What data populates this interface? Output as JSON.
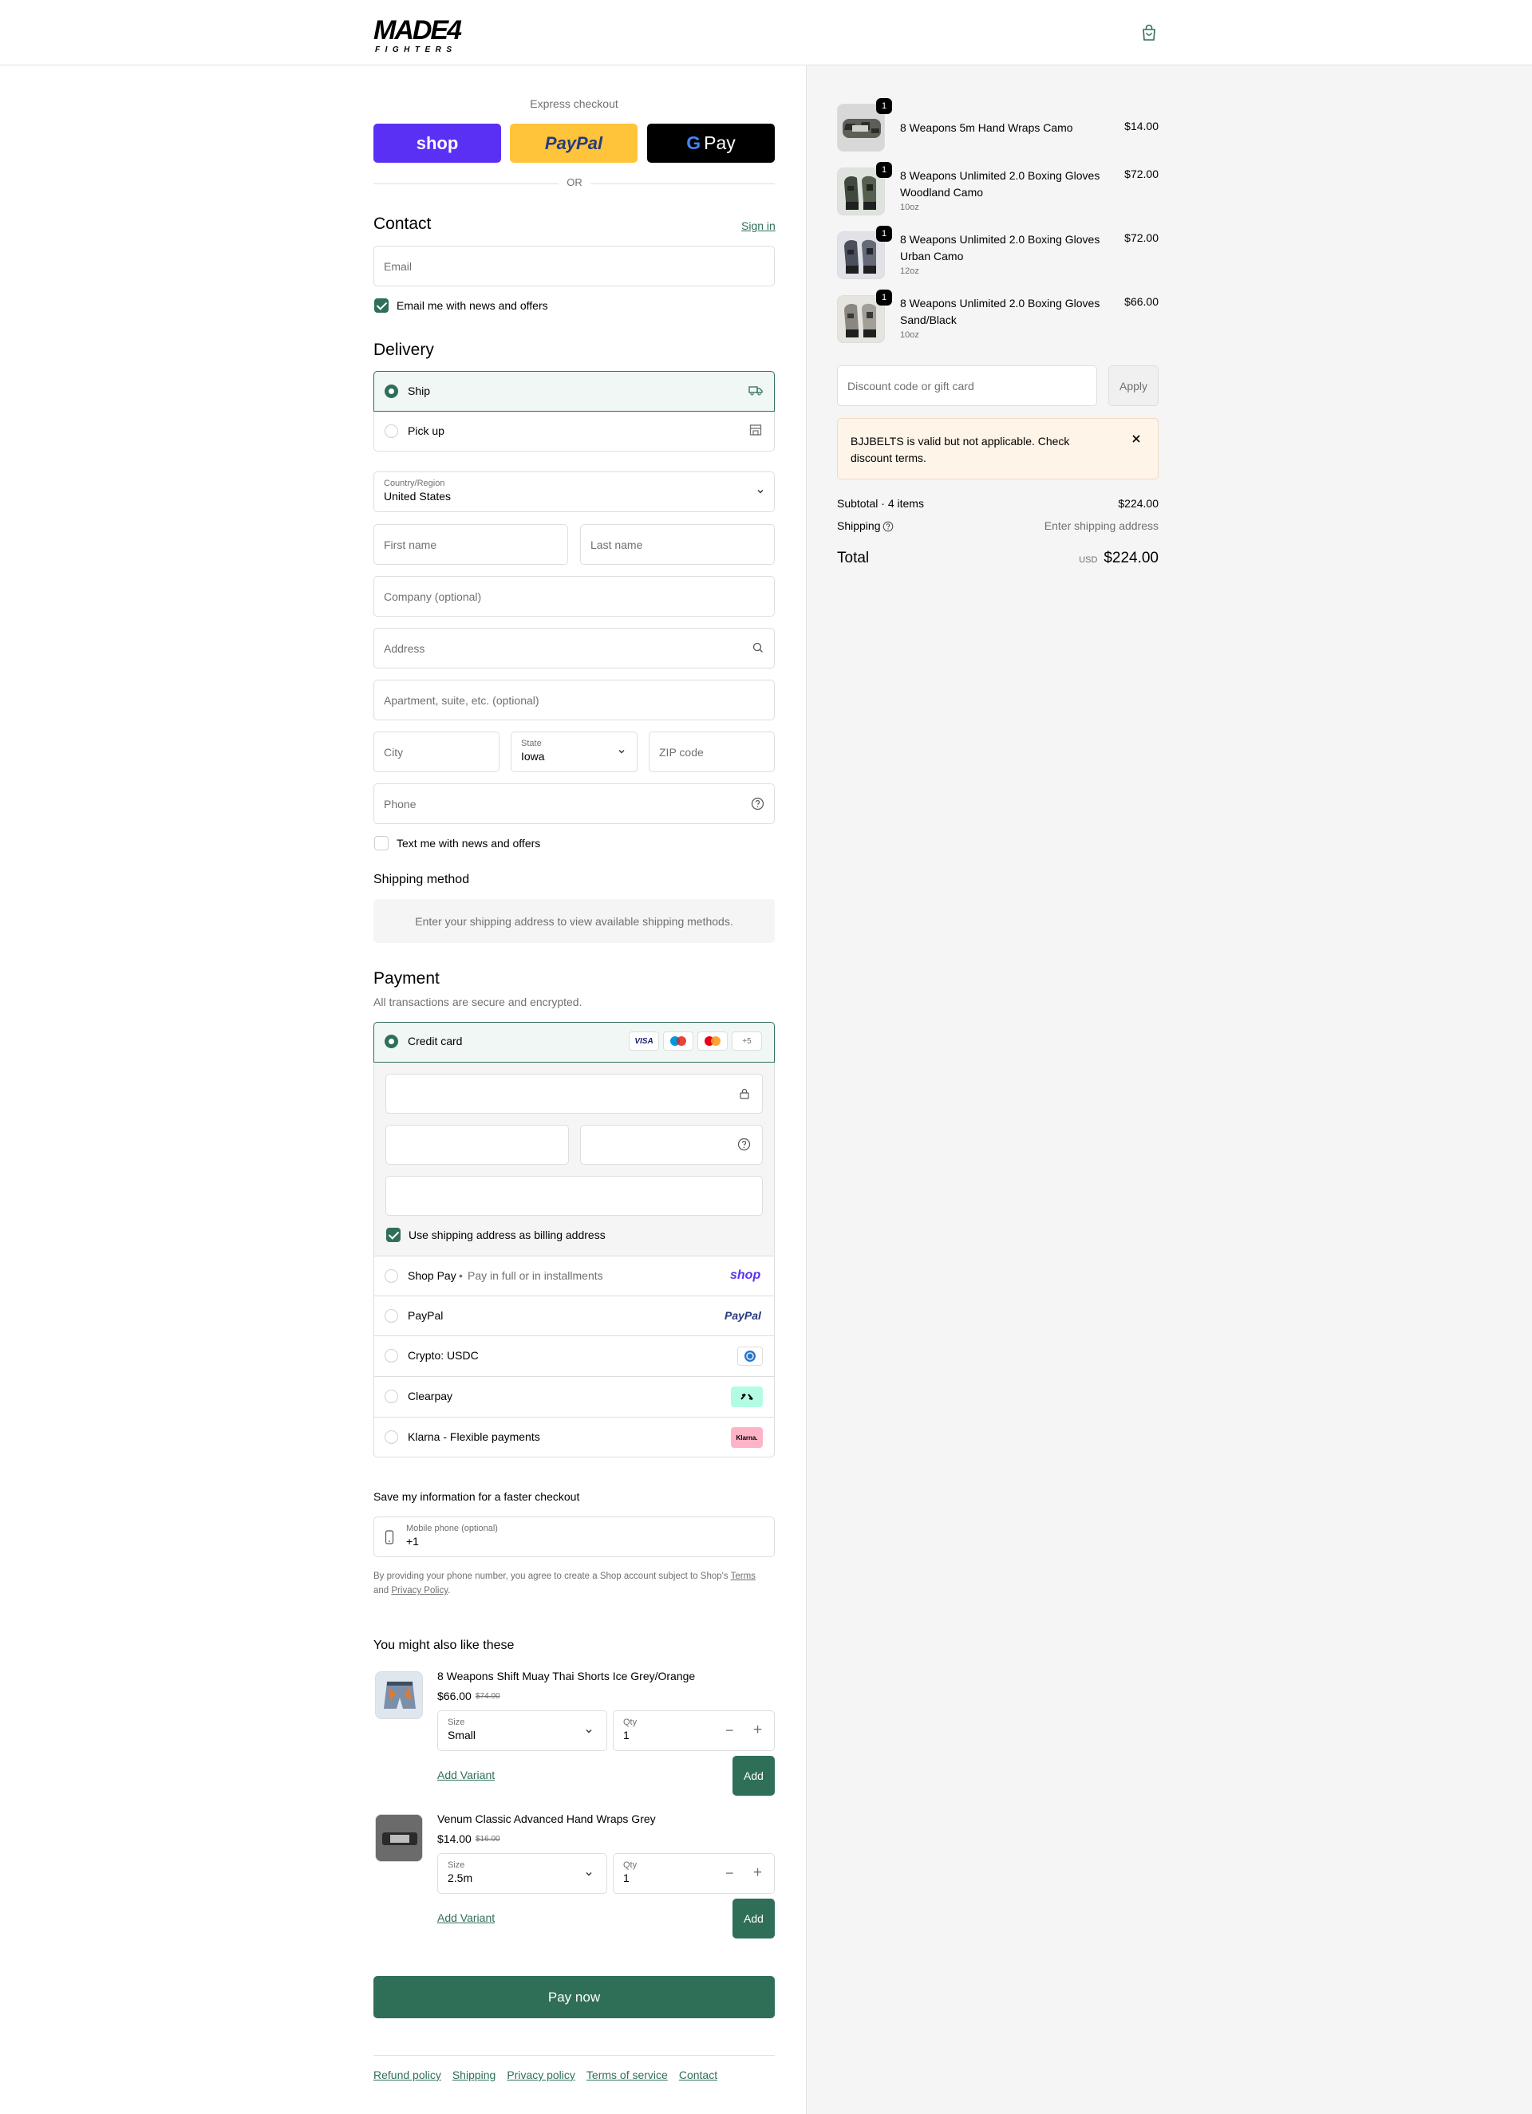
{
  "header": {
    "logo_text": "MADE4",
    "logo_sub": "FIGHTERS",
    "cart_icon": "shopping-bag-icon"
  },
  "express": {
    "title": "Express checkout",
    "shop_label": "shop",
    "paypal_label": "PayPal",
    "gpay_label": "Pay",
    "or": "OR"
  },
  "contact": {
    "title": "Contact",
    "sign_in": "Sign in",
    "email_placeholder": "Email",
    "news_label": "Email me with news and offers"
  },
  "delivery": {
    "title": "Delivery",
    "ship": "Ship",
    "pickup": "Pick up",
    "country_label": "Country/Region",
    "country_value": "United States",
    "first_name": "First name",
    "last_name": "Last name",
    "company": "Company (optional)",
    "address": "Address",
    "apartment": "Apartment, suite, etc. (optional)",
    "city": "City",
    "state_label": "State",
    "state_value": "Iowa",
    "zip": "ZIP code",
    "phone": "Phone",
    "text_label": "Text me with news and offers"
  },
  "shipping_method": {
    "title": "Shipping method",
    "note": "Enter your shipping address to view available shipping methods."
  },
  "payment": {
    "title": "Payment",
    "subtitle": "All transactions are secure and encrypted.",
    "credit_card": "Credit card",
    "card_visa": "VISA",
    "card_more": "+5",
    "billing_label": "Use shipping address as billing address",
    "shop_pay": "Shop Pay",
    "shop_pay_note": "Pay in full or in installments",
    "shop_pay_logo": "shop",
    "paypal": "PayPal",
    "paypal_logo": "PayPal",
    "crypto": "Crypto: USDC",
    "clearpay": "Clearpay",
    "klarna": "Klarna - Flexible payments",
    "klarna_logo": "Klarna."
  },
  "save_info": {
    "title": "Save my information for a faster checkout",
    "phone_label": "Mobile phone (optional)",
    "phone_value": "+1",
    "legal_1": "By providing your phone number, you agree to create a Shop account subject to Shop's",
    "terms": "Terms",
    "and": "and",
    "privacy": "Privacy Policy",
    "period": "."
  },
  "upsell": {
    "title": "You might also like these",
    "items": [
      {
        "name": "8 Weapons Shift Muay Thai Shorts Ice Grey/Orange",
        "price": "$66.00",
        "compare": "$74.00",
        "size_label": "Size",
        "size_value": "Small",
        "qty_label": "Qty",
        "qty_value": "1",
        "add_variant": "Add Variant",
        "add": "Add"
      },
      {
        "name": "Venum Classic Advanced Hand Wraps Grey",
        "price": "$14.00",
        "compare": "$16.00",
        "size_label": "Size",
        "size_value": "2.5m",
        "qty_label": "Qty",
        "qty_value": "1",
        "add_variant": "Add Variant",
        "add": "Add"
      }
    ]
  },
  "pay_now": "Pay now",
  "footer": {
    "links": [
      "Refund policy",
      "Shipping",
      "Privacy policy",
      "Terms of service",
      "Contact"
    ]
  },
  "summary": {
    "items": [
      {
        "qty": "1",
        "name": "8 Weapons 5m Hand Wraps Camo",
        "variant": "",
        "price": "$14.00"
      },
      {
        "qty": "1",
        "name": "8 Weapons Unlimited 2.0 Boxing Gloves Woodland Camo",
        "variant": "10oz",
        "price": "$72.00"
      },
      {
        "qty": "1",
        "name": "8 Weapons Unlimited 2.0 Boxing Gloves Urban Camo",
        "variant": "12oz",
        "price": "$72.00"
      },
      {
        "qty": "1",
        "name": "8 Weapons Unlimited 2.0 Boxing Gloves Sand/Black",
        "variant": "10oz",
        "price": "$66.00"
      }
    ],
    "discount_placeholder": "Discount code or gift card",
    "apply": "Apply",
    "alert": "BJJBELTS is valid but not applicable. Check discount terms.",
    "subtotal_label": "Subtotal · 4 items",
    "subtotal_value": "$224.00",
    "shipping_label": "Shipping",
    "shipping_value": "Enter shipping address",
    "total_label": "Total",
    "currency": "USD",
    "total_value": "$224.00"
  },
  "colors": {
    "accent": "#2f6f58",
    "shop": "#5a31f4",
    "paypal": "#ffc439",
    "alert_bg": "#fff4e8"
  }
}
